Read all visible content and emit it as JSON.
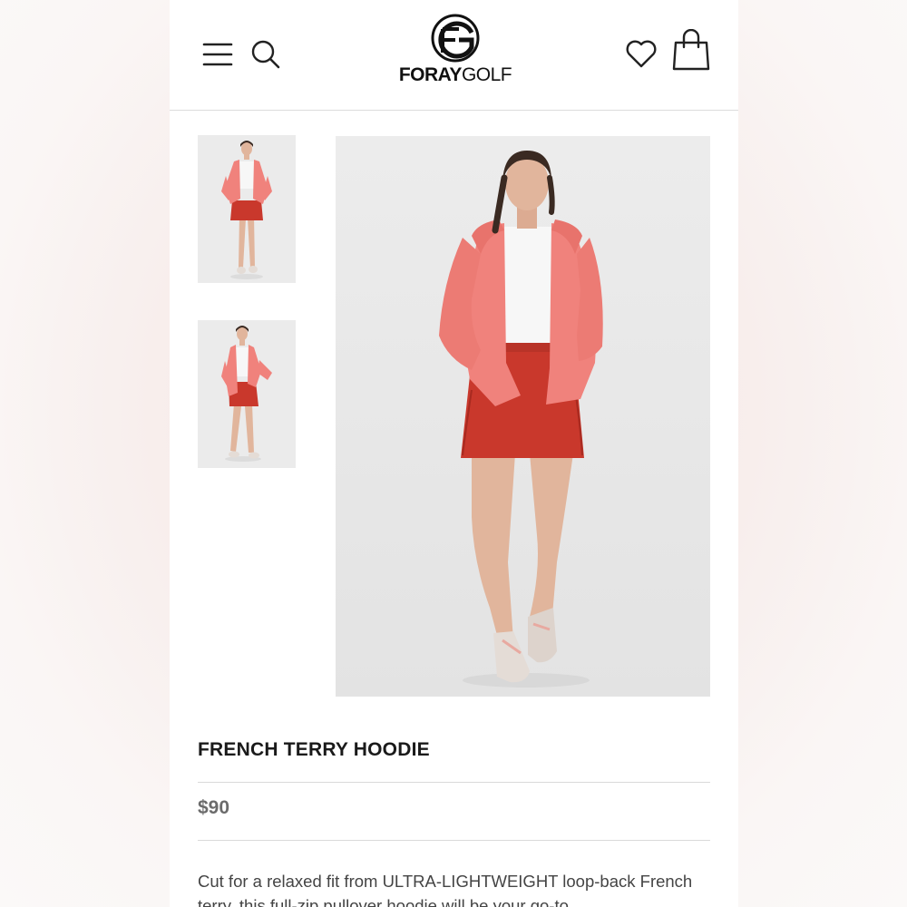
{
  "header": {
    "logo_bold": "FORAY",
    "logo_light": "GOLF",
    "icons": {
      "menu": "hamburger-menu-icon",
      "search": "search-icon",
      "wishlist": "heart-icon",
      "cart": "shopping-bag-icon"
    }
  },
  "gallery": {
    "thumbnail_count": 2,
    "colors": {
      "jacket": "#f0827c",
      "shorts": "#c9382c",
      "top": "#f7f7f7",
      "skin": "#e1b59c",
      "hair": "#3a2a22",
      "shoes": "#e4dcd6"
    }
  },
  "product": {
    "title": "FRENCH TERRY HOODIE",
    "price": "$90",
    "description": "Cut for a relaxed fit from ULTRA-LIGHTWEIGHT loop-back French terry, this full-zip pullover hoodie will be your go-to"
  }
}
